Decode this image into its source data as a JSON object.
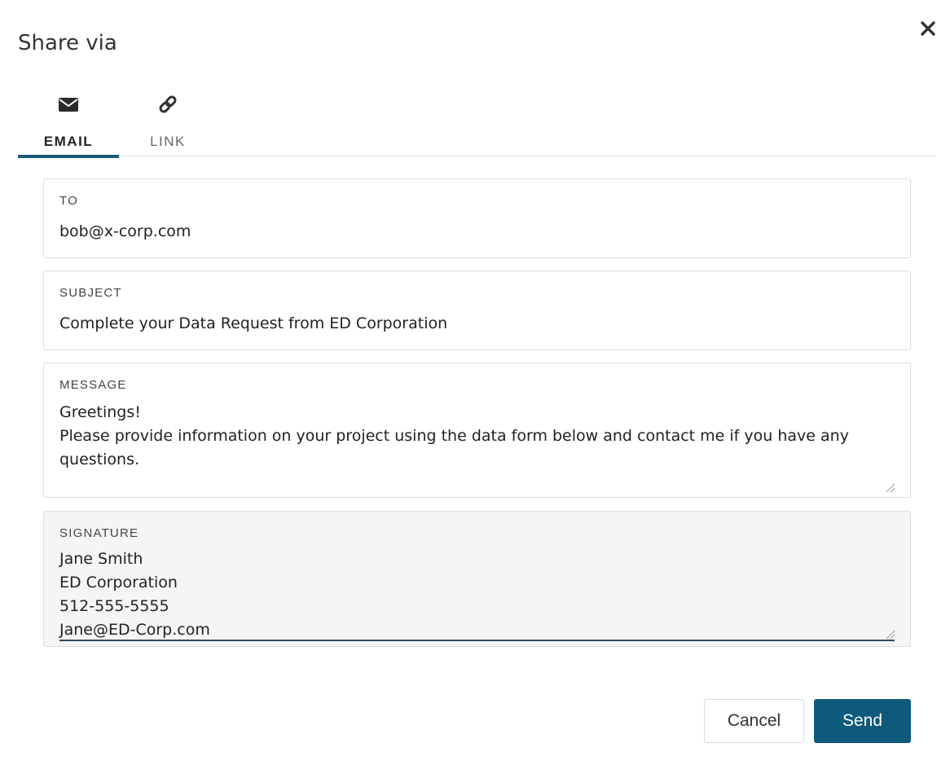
{
  "dialog": {
    "title": "Share via"
  },
  "tabs": [
    {
      "label": "EMAIL",
      "icon": "envelope-icon",
      "active": true
    },
    {
      "label": "LINK",
      "icon": "link-icon",
      "active": false
    }
  ],
  "form": {
    "to": {
      "label": "TO",
      "value": "bob@x-corp.com"
    },
    "subject": {
      "label": "SUBJECT",
      "value": "Complete your Data Request from ED Corporation"
    },
    "message": {
      "label": "MESSAGE",
      "value": "Greetings!\nPlease provide information on your project using the data form below and contact me if you have any questions."
    },
    "signature": {
      "label": "SIGNATURE",
      "value": "Jane Smith\nED Corporation\n512-555-5555\nJane@ED-Corp.com"
    }
  },
  "buttons": {
    "cancel": "Cancel",
    "send": "Send"
  },
  "colors": {
    "accent": "#1b5a7a",
    "primary_button": "#0e5a7d"
  }
}
